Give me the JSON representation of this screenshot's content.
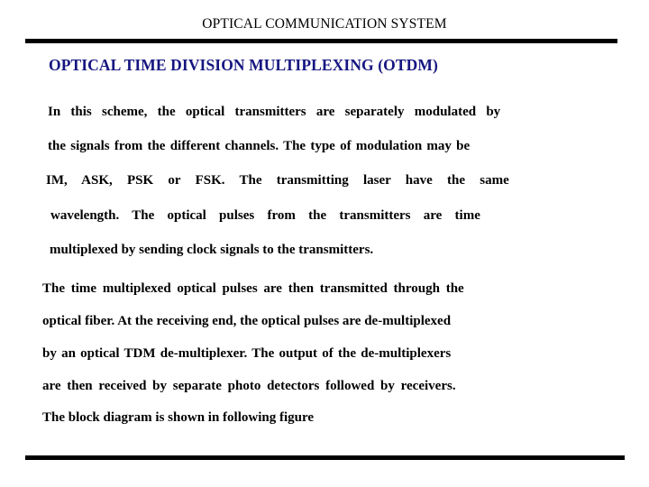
{
  "slide": {
    "background_color": "#ffffff",
    "header": {
      "title": "OPTICAL COMMUNICATION SYSTEM",
      "rule_color": "#000000"
    },
    "section_heading": {
      "text": "OPTICAL TIME DIVISION MULTIPLEXING (OTDM)",
      "color": "#161681"
    },
    "paragraphs": [
      {
        "id": "paragraph-otdm-scheme",
        "lines": [
          "In this scheme,  the optical transmitters are separately modulated by",
          "the signals from the different channels.  The type of modulation may be",
          "IM, ASK, PSK or FSK. The transmitting laser have the same",
          "wavelength. The optical pulses from the transmitters are time",
          "multiplexed by sending clock signals to the transmitters."
        ],
        "full_text": "In this scheme, the optical transmitters are separately modulated by the signals from the different channels. The type of modulation may be IM, ASK, PSK or FSK. The transmitting laser have the same wavelength. The optical pulses from the transmitters are time multiplexed by sending clock signals to the transmitters."
      },
      {
        "id": "paragraph-otdm-demux",
        "lines": [
          "The time multiplexed optical pulses are then transmitted through the",
          "optical fiber. At the receiving end, the optical pulses are de-multiplexed",
          "by an optical TDM de-multiplexer. The output of the de-multiplexers",
          "are then received by separate photo detectors  followed by receivers.",
          "The block diagram is shown in following figure"
        ],
        "full_text": "The time multiplexed optical pulses are then transmitted through the optical fiber. At the receiving end, the optical pulses are de-multiplexed by an optical TDM de-multiplexer. The output of the de-multiplexers are then received by separate photo detectors followed by receivers. The block diagram is shown in following figure"
      }
    ]
  }
}
